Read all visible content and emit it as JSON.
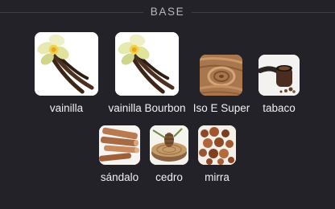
{
  "section": {
    "title": "BASE"
  },
  "notes": [
    {
      "label": "vainilla",
      "icon": "vanilla-flower-icon"
    },
    {
      "label": "vainilla Bourbon",
      "icon": "vanilla-flower-icon"
    },
    {
      "label": "Iso E Super",
      "icon": "wood-grain-icon"
    },
    {
      "label": "tabaco",
      "icon": "tobacco-pipe-icon"
    },
    {
      "label": "sándalo",
      "icon": "sandalwood-sticks-icon"
    },
    {
      "label": "cedro",
      "icon": "cedar-log-icon"
    },
    {
      "label": "mirra",
      "icon": "myrrh-resin-icon"
    }
  ]
}
